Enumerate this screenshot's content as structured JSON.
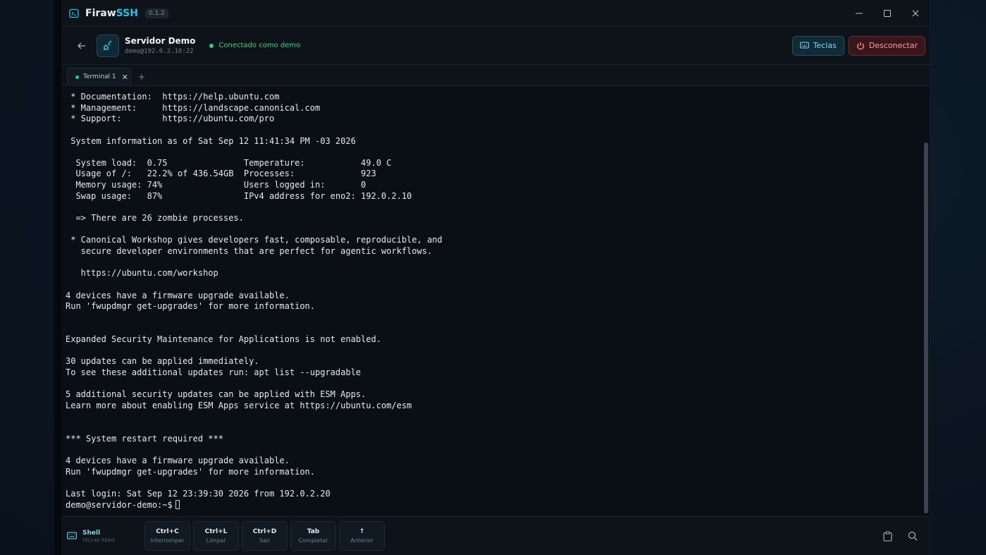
{
  "app": {
    "name_main": "Firaw",
    "name_accent": "SSH",
    "version": "0.1.2"
  },
  "header": {
    "server_name": "Servidor Demo",
    "server_address": "demo@192.0.2.10:22",
    "status_text": "Conectado como demo",
    "keys_button": "Teclas",
    "disconnect_button": "Desconectar"
  },
  "tabs": [
    {
      "label": "Terminal 1",
      "active": true
    }
  ],
  "tab_add_label": "+",
  "terminal": {
    "lines": [
      " * Documentation:  https://help.ubuntu.com",
      " * Management:     https://landscape.canonical.com",
      " * Support:        https://ubuntu.com/pro",
      "",
      " System information as of Sat Sep 12 11:41:34 PM -03 2026",
      "",
      "  System load:  0.75               Temperature:           49.0 C",
      "  Usage of /:   22.2% of 436.54GB  Processes:             923",
      "  Memory usage: 74%                Users logged in:       0",
      "  Swap usage:   87%                IPv4 address for eno2: 192.0.2.10",
      "",
      "  => There are 26 zombie processes.",
      "",
      " * Canonical Workshop gives developers fast, composable, reproducible, and",
      "   secure developer environments that are perfect for agentic workflows.",
      "",
      "   https://ubuntu.com/workshop",
      "",
      "4 devices have a firmware upgrade available.",
      "Run 'fwupdmgr get-upgrades' for more information.",
      "",
      "",
      "Expanded Security Maintenance for Applications is not enabled.",
      "",
      "30 updates can be applied immediately.",
      "To see these additional updates run: apt list --upgradable",
      "",
      "5 additional security updates can be applied with ESM Apps.",
      "Learn more about enabling ESM Apps service at https://ubuntu.com/esm",
      "",
      "",
      "*** System restart required ***",
      "",
      "4 devices have a firmware upgrade available.",
      "Run 'fwupdmgr get-upgrades' for more information.",
      "",
      "Last login: Sat Sep 12 23:39:30 2026 from 192.0.2.20"
    ],
    "prompt": "demo@servidor-demo:~$"
  },
  "bottombar": {
    "shell_title": "Shell",
    "shell_subtitle": "TECLAS REAIS",
    "keys": [
      {
        "key": "Ctrl+C",
        "desc": "Interromper"
      },
      {
        "key": "Ctrl+L",
        "desc": "Limpar"
      },
      {
        "key": "Ctrl+D",
        "desc": "Sair"
      },
      {
        "key": "Tab",
        "desc": "Completar"
      },
      {
        "key": "↑",
        "desc": "Anterior"
      }
    ]
  },
  "colors": {
    "accent": "#22c3e6",
    "status_green": "#2fd06b",
    "danger": "#ff9aa3"
  },
  "icons": {
    "app": "terminal-icon",
    "back": "arrow-left-icon",
    "server": "plug-icon",
    "keys": "keyboard-icon",
    "disconnect": "power-icon",
    "clipboard": "clipboard-icon",
    "search": "search-icon"
  }
}
